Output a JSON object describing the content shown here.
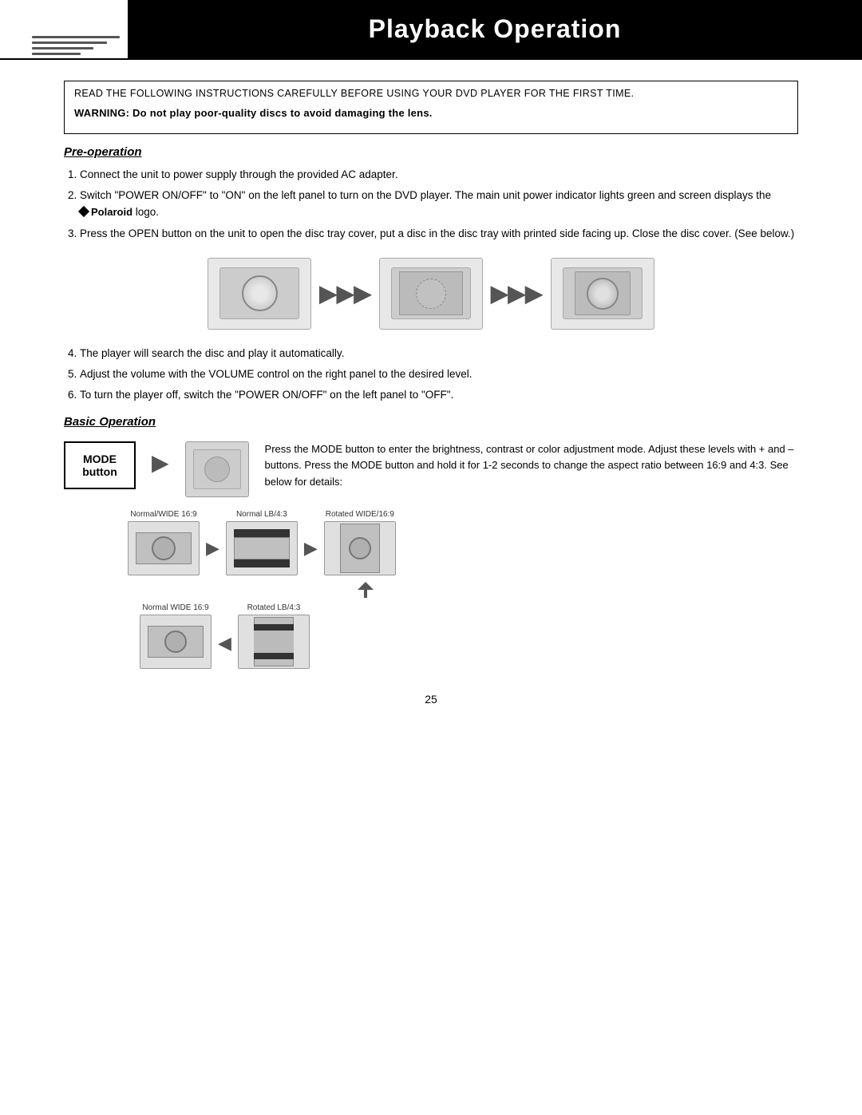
{
  "header": {
    "title": "Playback Operation"
  },
  "warning_box": {
    "instructions": "READ THE FOLLOWING INSTRUCTIONS CAREFULLY BEFORE USING YOUR DVD PLAYER FOR THE FIRST TIME.",
    "warning": "WARNING: Do not play poor-quality discs to avoid damaging the lens."
  },
  "pre_operation": {
    "title": "Pre-operation",
    "steps": [
      "Connect the unit to power supply through the provided AC adapter.",
      "Switch \"POWER ON/OFF\" to \"ON\" on the left panel to turn on the DVD player. The main unit power indicator lights green and screen displays the  Polaroid logo.",
      "Press the OPEN button on the unit to open the disc tray cover, put a disc in the disc tray with printed side facing up. Close the disc cover. (See below.)",
      "The player will search the disc and play it automatically.",
      "Adjust the volume with the VOLUME control on the right panel to the desired level.",
      "To turn the player off, switch the \"POWER ON/OFF\" on the left panel to \"OFF\"."
    ]
  },
  "basic_operation": {
    "title": "Basic Operation",
    "mode_button_label": "MODE\nbutton",
    "description": "Press the MODE button to enter the brightness, contrast or color adjustment mode. Adjust these levels with + and – buttons. Press the MODE button and hold it for 1-2 seconds to change the aspect ratio between 16:9 and 4:3. See below for details:",
    "aspect_labels": {
      "normal_wide_169_1": "Normal/WIDE 16:9",
      "normal_lb_43": "Normal LB/4:3",
      "rotated_wide_169": "Rotated WIDE/16:9",
      "normal_wide_169_2": "Normal WIDE 16:9",
      "rotated_lb_43": "Rotated LB/4:3"
    }
  },
  "page_number": "25"
}
